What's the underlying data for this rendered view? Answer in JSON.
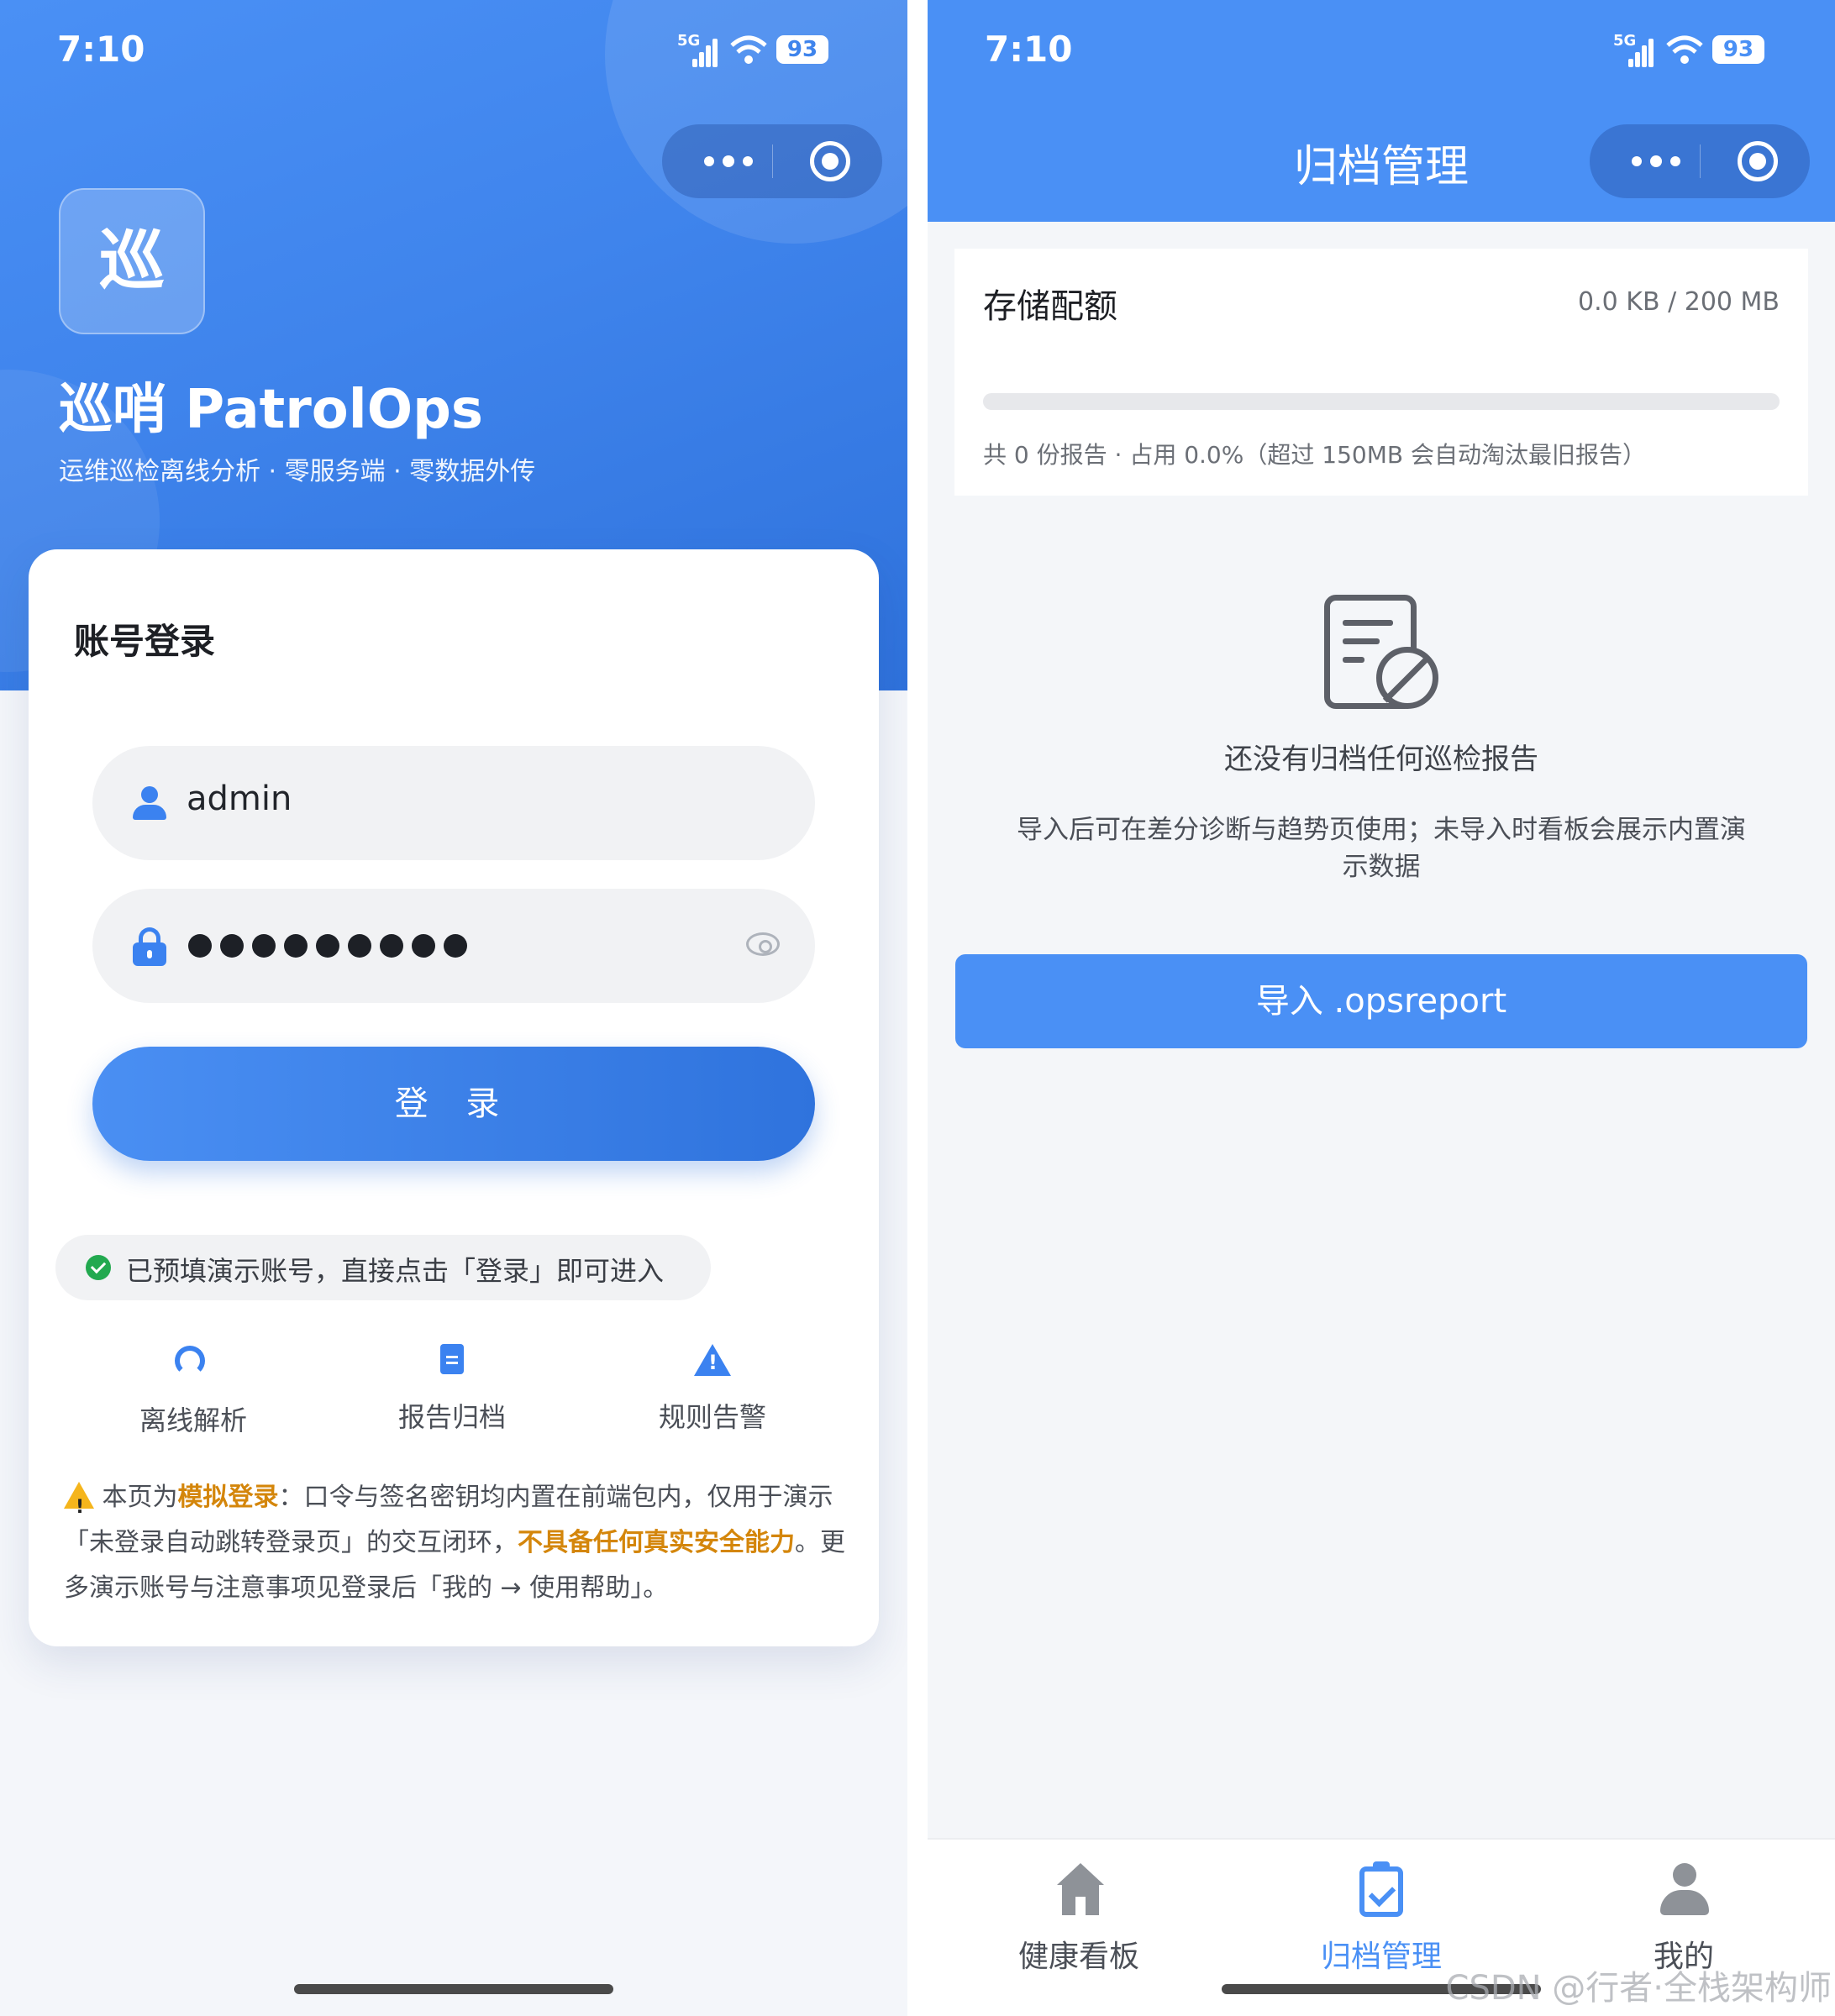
{
  "login_screen": {
    "status_bar": {
      "time": "7:10",
      "network": "5G",
      "battery": "93"
    },
    "logo_char": "巡",
    "brand": "巡哨 PatrolOps",
    "tagline": "运维巡检离线分析 · 零服务端 · 零数据外传",
    "card_title": "账号登录",
    "username_value": "admin",
    "password_mask_length": 9,
    "login_button": "登 录",
    "hint": "已预填演示账号，直接点击「登录」即可进入",
    "features": [
      {
        "label": "离线解析",
        "icon": "headset-icon"
      },
      {
        "label": "报告归档",
        "icon": "document-icon"
      },
      {
        "label": "规则告警",
        "icon": "warning-icon"
      }
    ],
    "notice": {
      "part1": "本页为",
      "hl1": "模拟登录",
      "part2": "：口令与签名密钥均内置在前端包内，仅用于演示「未登录自动跳转登录页」的交互闭环，",
      "hl2": "不具备任何真实安全能力",
      "part3": "。更多演示账号与注意事项见登录后「我的 → 使用帮助」。"
    }
  },
  "archive_screen": {
    "status_bar": {
      "time": "7:10",
      "network": "5G",
      "battery": "93"
    },
    "nav_title": "归档管理",
    "quota": {
      "label": "存储配额",
      "value": "0.0 KB / 200 MB",
      "used_fraction": 0.0,
      "info": "共 0 份报告 · 占用 0.0%（超过 150MB 会自动淘汰最旧报告）"
    },
    "empty": {
      "title": "还没有归档任何巡检报告",
      "desc": "导入后可在差分诊断与趋势页使用；未导入时看板会展示内置演示数据"
    },
    "import_button": "导入 .opsreport",
    "tabs": [
      {
        "label": "健康看板",
        "icon": "home-icon",
        "active": false
      },
      {
        "label": "归档管理",
        "icon": "clipboard-check-icon",
        "active": true
      },
      {
        "label": "我的",
        "icon": "person-icon",
        "active": false
      }
    ]
  },
  "watermark": "CSDN @行者·全栈架构师",
  "colors": {
    "primary": "#4a90f5",
    "warning": "#d4860b",
    "success": "#22a94f"
  }
}
